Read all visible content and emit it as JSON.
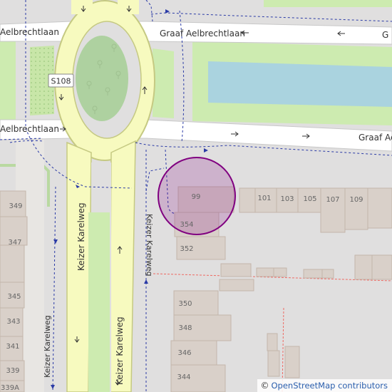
{
  "map": {
    "street_labels": {
      "graaf_top_left": "Aelbrechtlaan",
      "graaf_top_right": "Graaf Aelbrechtlaan",
      "graaf_top_edge": "G",
      "graaf_bottom_left": "Aelbrechtlaan",
      "graaf_bottom_right": "Graaf Ae",
      "keizer_left": "Keizer Karelweg",
      "keizer_center": "Keizer Karelweg",
      "keizer_right": "Keizer Karelweg",
      "keizer_bottom": "Keizer Karelweg"
    },
    "route_shield": "S108",
    "house_numbers": {
      "n99": "99",
      "n101": "101",
      "n103": "103",
      "n105": "105",
      "n107": "107",
      "n109": "109",
      "n354": "354",
      "n352": "352",
      "n350": "350",
      "n348": "348",
      "n346": "346",
      "n344": "344",
      "n349": "349",
      "n347": "347",
      "n345": "345",
      "n343": "343",
      "n341": "341",
      "n339": "339",
      "n339a": "339A"
    },
    "marker": {
      "color": "#800080",
      "fill_opacity": 0.2
    },
    "colors": {
      "background": "#e0dfdf",
      "road_primary": "#f7fabf",
      "road_primary_casing": "#c5c982",
      "grass": "#cdebb0",
      "park_green": "#aed1a0",
      "water": "#aad3df",
      "building": "#d9d0c9",
      "building_outline": "#c4b6ab",
      "road_residential": "#ffffff"
    }
  },
  "attribution": {
    "symbol": "©",
    "text": "OpenStreetMap contributors"
  }
}
